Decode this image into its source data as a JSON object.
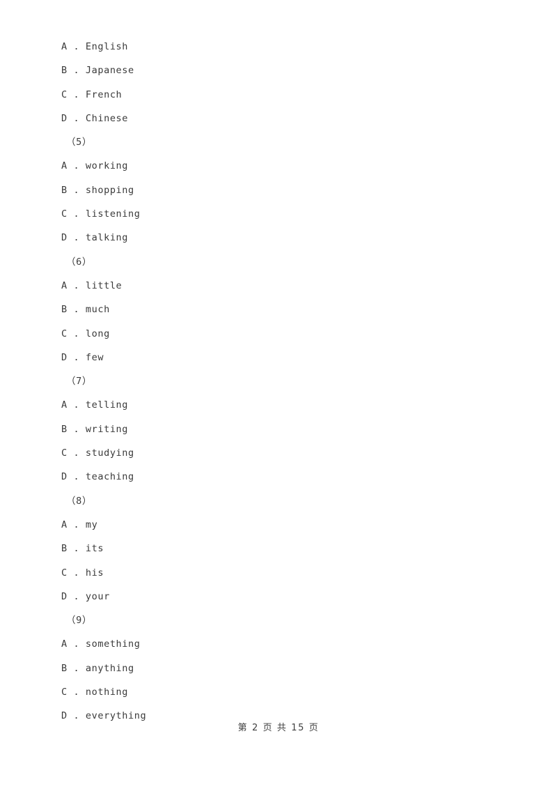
{
  "page": {
    "background_color": "#ffffff",
    "text_color": "#3a3a3a"
  },
  "body_lines": [
    {
      "type": "option",
      "text": "A . English"
    },
    {
      "type": "option",
      "text": "B . Japanese"
    },
    {
      "type": "option",
      "text": "C . French"
    },
    {
      "type": "option",
      "text": "D . Chinese"
    },
    {
      "type": "qnum",
      "text": "（5）"
    },
    {
      "type": "option",
      "text": "A . working"
    },
    {
      "type": "option",
      "text": "B . shopping"
    },
    {
      "type": "option",
      "text": "C . listening"
    },
    {
      "type": "option",
      "text": "D . talking"
    },
    {
      "type": "qnum",
      "text": "（6）"
    },
    {
      "type": "option",
      "text": "A . little"
    },
    {
      "type": "option",
      "text": "B . much"
    },
    {
      "type": "option",
      "text": "C . long"
    },
    {
      "type": "option",
      "text": "D . few"
    },
    {
      "type": "qnum",
      "text": "（7）"
    },
    {
      "type": "option",
      "text": "A . telling"
    },
    {
      "type": "option",
      "text": "B . writing"
    },
    {
      "type": "option",
      "text": "C . studying"
    },
    {
      "type": "option",
      "text": "D . teaching"
    },
    {
      "type": "qnum",
      "text": "（8）"
    },
    {
      "type": "option",
      "text": "A . my"
    },
    {
      "type": "option",
      "text": "B . its"
    },
    {
      "type": "option",
      "text": "C . his"
    },
    {
      "type": "option",
      "text": "D . your"
    },
    {
      "type": "qnum",
      "text": "（9）"
    },
    {
      "type": "option",
      "text": "A . something"
    },
    {
      "type": "option",
      "text": "B . anything"
    },
    {
      "type": "option",
      "text": "C . nothing"
    },
    {
      "type": "option",
      "text": "D . everything"
    }
  ],
  "footer": {
    "text": "第 2 页 共 15 页",
    "current_page": "2",
    "total_pages": "15"
  }
}
